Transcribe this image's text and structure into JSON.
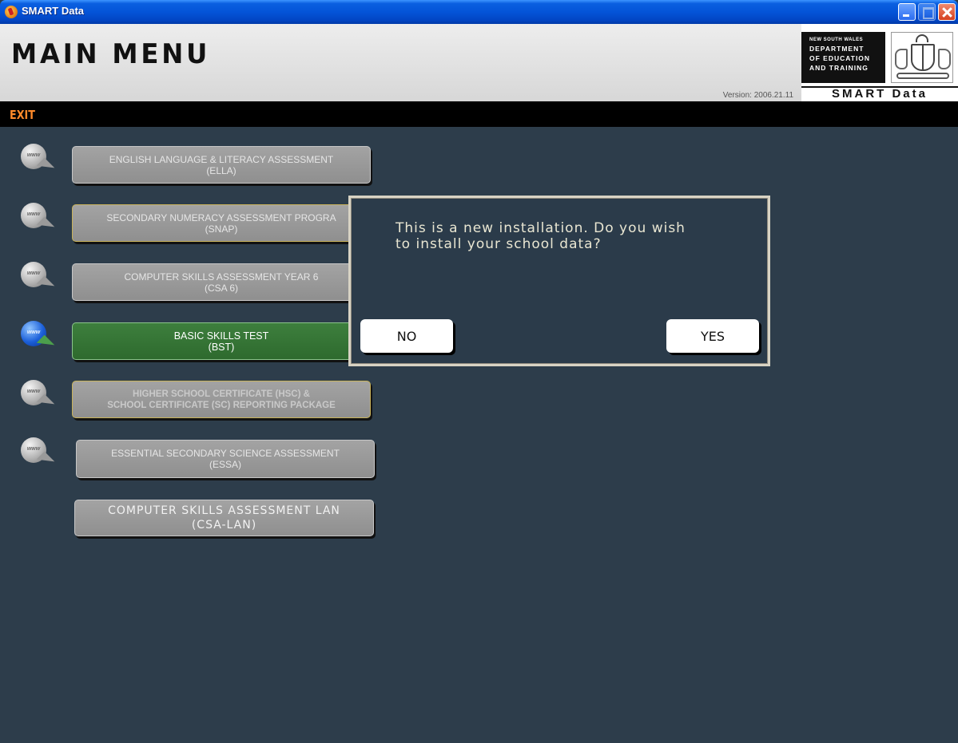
{
  "window": {
    "title": "SMART Data",
    "controls": [
      "minimize-icon",
      "maximize-icon",
      "close-icon"
    ]
  },
  "header": {
    "title": "MAIN MENU",
    "version": "Version: 2006.21.11",
    "logo": {
      "line1": "NEW SOUTH WALES",
      "line2": "DEPARTMENT",
      "line3": "OF EDUCATION",
      "line4": "AND TRAINING",
      "badge": "SMART Data"
    }
  },
  "toolbar": {
    "exit_label": "EXIT",
    "exit_color": "#ff8a2a"
  },
  "menu": {
    "items": [
      {
        "line1": "ENGLISH LANGUAGE & LITERACY ASSESSMENT",
        "line2": "(ELLA)",
        "icon": "www-globe-icon"
      },
      {
        "line1": "SECONDARY NUMERACY ASSESSMENT PROGRA",
        "line2": "(SNAP)",
        "icon": "www-globe-icon"
      },
      {
        "line1": "COMPUTER SKILLS ASSESSMENT YEAR 6",
        "line2": "(CSA 6)",
        "icon": "www-globe-icon"
      },
      {
        "line1": "BASIC SKILLS TEST",
        "line2": "(BST)",
        "icon": "www-globe-icon",
        "active": true
      },
      {
        "line1": "HIGHER SCHOOL CERTIFICATE (HSC) &",
        "line2": "SCHOOL CERTIFICATE (SC) REPORTING PACKAGE",
        "icon": "www-globe-icon"
      },
      {
        "line1": "ESSENTIAL SECONDARY SCIENCE ASSESSMENT",
        "line2": "(ESSA)",
        "icon": "www-globe-icon"
      },
      {
        "line1": "COMPUTER SKILLS ASSESSMENT LAN",
        "line2": "(CSA-LAN)"
      }
    ],
    "globe_text": "www",
    "active_color": "#3d7f3d"
  },
  "dialog": {
    "message_line1": "This is a new installation. Do you wish",
    "message_line2": "to install your school data?",
    "no_label": "NO",
    "yes_label": "YES"
  }
}
